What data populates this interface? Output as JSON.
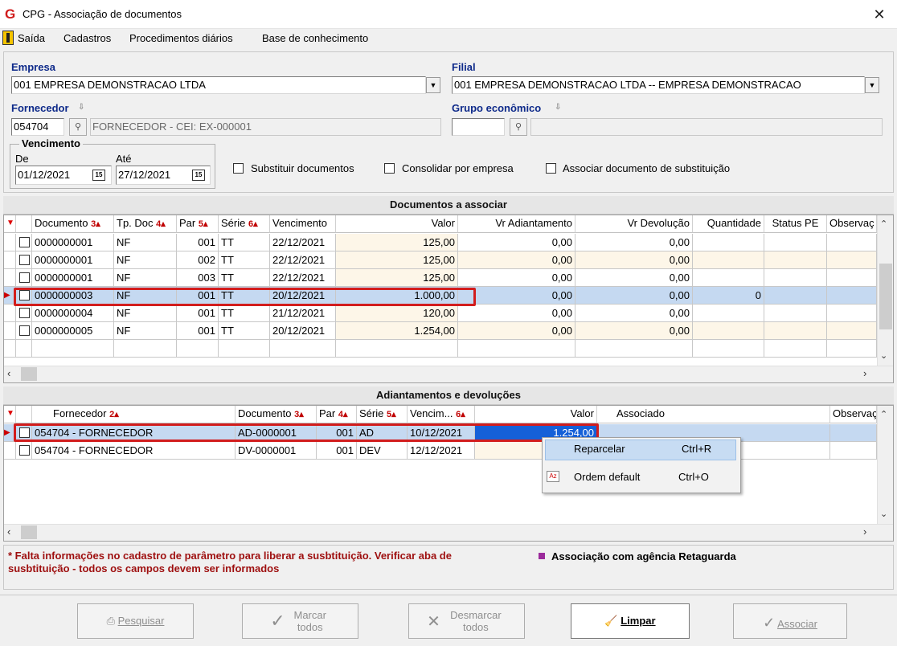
{
  "window": {
    "title": "CPG - Associação de documentos",
    "logo": "G",
    "close": "✕"
  },
  "menu": {
    "items": [
      "Saída",
      "Cadastros",
      "Procedimentos diários",
      "Base de conhecimento"
    ]
  },
  "filters": {
    "empresa_label": "Empresa",
    "empresa_value": "001 EMPRESA DEMONSTRACAO LTDA",
    "filial_label": "Filial",
    "filial_value": "001 EMPRESA DEMONSTRACAO LTDA -- EMPRESA DEMONSTRACAO",
    "fornecedor_label": "Fornecedor",
    "fornecedor_code": "054704",
    "fornecedor_name": "FORNECEDOR - CEI: EX-000001",
    "grupo_label": "Grupo econômico",
    "grupo_code": "",
    "grupo_name": "",
    "vencimento_label": "Vencimento",
    "de_label": "De",
    "de_value": "01/12/2021",
    "ate_label": "Até",
    "ate_value": "27/12/2021",
    "checkboxes": [
      "Substituir documentos",
      "Consolidar por empresa",
      "Associar documento de substituição"
    ]
  },
  "documentos": {
    "title": "Documentos a associar",
    "headers": [
      "Documento",
      "Tp. Doc",
      "Par",
      "Série",
      "Vencimento",
      "Valor",
      "Vr Adiantamento",
      "Vr Devolução",
      "Quantidade",
      "Status PE",
      "Observaç"
    ],
    "sort_marks": [
      "3",
      "4",
      "5",
      "6"
    ],
    "rows": [
      [
        "0000000001",
        "NF",
        "001",
        "TT",
        "22/12/2021",
        "125,00",
        "0,00",
        "0,00",
        "",
        "",
        ""
      ],
      [
        "0000000001",
        "NF",
        "002",
        "TT",
        "22/12/2021",
        "125,00",
        "0,00",
        "0,00",
        "",
        "",
        ""
      ],
      [
        "0000000001",
        "NF",
        "003",
        "TT",
        "22/12/2021",
        "125,00",
        "0,00",
        "0,00",
        "",
        "",
        ""
      ],
      [
        "0000000003",
        "NF",
        "001",
        "TT",
        "20/12/2021",
        "1.000,00",
        "0,00",
        "0,00",
        "0",
        "",
        ""
      ],
      [
        "0000000004",
        "NF",
        "001",
        "TT",
        "21/12/2021",
        "120,00",
        "0,00",
        "0,00",
        "",
        "",
        ""
      ],
      [
        "0000000005",
        "NF",
        "001",
        "TT",
        "20/12/2021",
        "1.254,00",
        "0,00",
        "0,00",
        "",
        "",
        ""
      ]
    ]
  },
  "adiantamentos": {
    "title": "Adiantamentos e devoluções",
    "headers": [
      "Fornecedor",
      "Documento",
      "Par",
      "Série",
      "Vencim...",
      "Valor",
      "Associado",
      "Observaç"
    ],
    "sort_marks": [
      "2",
      "3",
      "4",
      "5",
      "6"
    ],
    "rows": [
      [
        "054704 - FORNECEDOR",
        "AD-0000001",
        "001",
        "AD",
        "10/12/2021",
        "1.254,00",
        "",
        ""
      ],
      [
        "054704 - FORNECEDOR",
        "DV-0000001",
        "001",
        "DEV",
        "12/12/2021",
        "",
        "",
        ""
      ]
    ]
  },
  "context_menu": {
    "items": [
      {
        "label": "Reparcelar",
        "shortcut": "Ctrl+R"
      },
      {
        "label": "Ordem default",
        "shortcut": "Ctrl+O"
      }
    ]
  },
  "notes": {
    "warning": "* Falta informações no cadastro de parâmetro para liberar a susbtituição. Verificar aba de susbtituição - todos os campos devem ser informados",
    "legend": "Associação com agência Retaguarda",
    "legend_color": "#9b2b9b"
  },
  "buttons": {
    "pesquisar": "Pesquisar",
    "marcar": "Marcar todos",
    "desmarcar": "Desmarcar todos",
    "limpar": "Limpar",
    "associar": "Associar"
  }
}
